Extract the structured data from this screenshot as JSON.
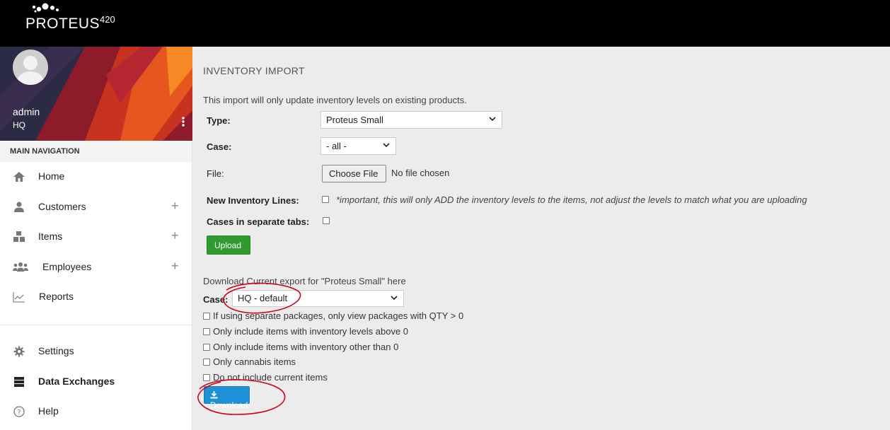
{
  "brand": {
    "name": "PROTEUS",
    "suffix": "420"
  },
  "user": {
    "name": "admin",
    "location": "HQ"
  },
  "nav": {
    "header": "MAIN NAVIGATION",
    "items": [
      {
        "label": "Home",
        "icon": "home-icon"
      },
      {
        "label": "Customers",
        "icon": "user-icon",
        "expand": "+"
      },
      {
        "label": "Items",
        "icon": "boxes-icon",
        "expand": "+"
      },
      {
        "label": "Employees",
        "icon": "group-icon",
        "expand": "+"
      },
      {
        "label": "Reports",
        "icon": "chart-icon"
      },
      {
        "label": "Settings",
        "icon": "gear-icon"
      },
      {
        "label": "Data Exchanges",
        "icon": "server-icon"
      },
      {
        "label": "Help",
        "icon": "help-icon"
      }
    ]
  },
  "main": {
    "title": "INVENTORY IMPORT",
    "note": "This import will only update inventory levels on existing products.",
    "form": {
      "type_label": "Type:",
      "type_value": "Proteus Small",
      "case_label": "Case:",
      "case_value": "- all -",
      "file_label": "File:",
      "file_button": "Choose File",
      "file_status": "No file chosen",
      "new_lines_label": "New Inventory Lines:",
      "new_lines_hint": "*important, this will only ADD the inventory levels to the items, not adjust the levels to match what you are uploading",
      "separate_tabs_label": "Cases in separate tabs:",
      "upload_button": "Upload"
    },
    "export": {
      "title": "Download Current export for \"Proteus Small\" here",
      "case_label": "Case:",
      "case_value": "HQ - default",
      "options": [
        "If using separate packages, only view packages with QTY > 0",
        "Only include items with inventory levels above 0",
        "Only include items with inventory other than 0",
        "Only cannabis items",
        "Do not include current items"
      ],
      "download_button": "Download"
    }
  },
  "colors": {
    "upload": "#2f9b2f",
    "download": "#1e90d6",
    "annotation": "#d0021b"
  }
}
